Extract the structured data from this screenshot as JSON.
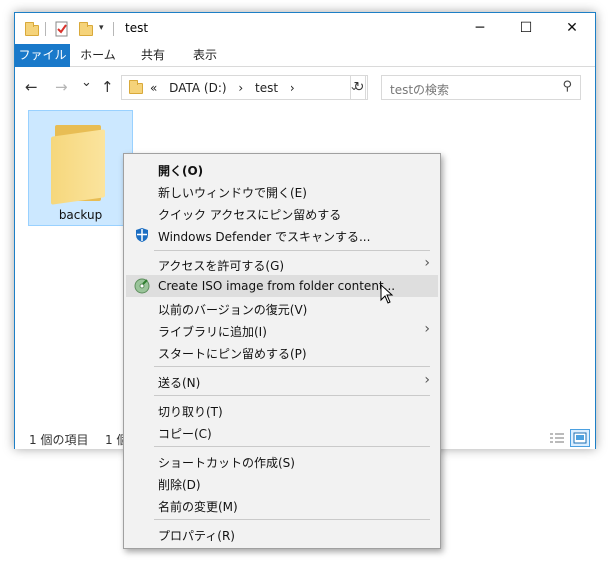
{
  "window": {
    "title": "test",
    "controls": {
      "minimize": "─",
      "maximize": "☐",
      "close": "✕"
    }
  },
  "ribbon": {
    "tabs": [
      "ファイル",
      "ホーム",
      "共有",
      "表示"
    ]
  },
  "nav": {
    "back": "←",
    "forward": "→",
    "recent": "⌄",
    "up": "↑",
    "path_overflow": "«",
    "path": [
      "DATA (D:)",
      "test"
    ],
    "path_sep": "›",
    "dropdown": "⌄",
    "refresh": "↻",
    "search_placeholder": "testの検索",
    "search_icon": "⚲"
  },
  "content": {
    "items": [
      {
        "name": "backup",
        "selected": true
      }
    ]
  },
  "status": {
    "count": "1 個の項目",
    "selected": "1 個"
  },
  "context_menu": {
    "groups": [
      [
        {
          "label": "開く(O)",
          "bold": true
        },
        {
          "label": "新しいウィンドウで開く(E)"
        },
        {
          "label": "クイック アクセスにピン留めする"
        },
        {
          "label": "Windows Defender でスキャンする...",
          "icon": "defender-shield-icon"
        }
      ],
      [
        {
          "label": "アクセスを許可する(G)",
          "submenu": true
        },
        {
          "label": "Create ISO image from folder content...",
          "icon": "iso-disc-icon",
          "hover": true
        },
        {
          "label": "以前のバージョンの復元(V)"
        },
        {
          "label": "ライブラリに追加(I)",
          "submenu": true
        },
        {
          "label": "スタートにピン留めする(P)"
        }
      ],
      [
        {
          "label": "送る(N)",
          "submenu": true
        }
      ],
      [
        {
          "label": "切り取り(T)"
        },
        {
          "label": "コピー(C)"
        }
      ],
      [
        {
          "label": "ショートカットの作成(S)"
        },
        {
          "label": "削除(D)"
        },
        {
          "label": "名前の変更(M)"
        }
      ],
      [
        {
          "label": "プロパティ(R)"
        }
      ]
    ],
    "submenu_arrow": "›"
  },
  "colors": {
    "accent": "#1979ca",
    "selection_bg": "#cce8ff",
    "menu_bg": "#f2f2f2",
    "menu_hover": "#dedede"
  }
}
